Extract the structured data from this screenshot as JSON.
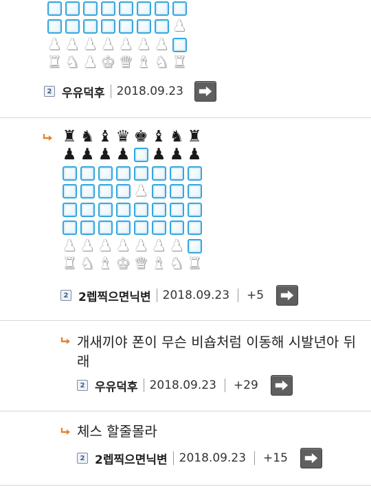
{
  "comments": [
    {
      "board_top": [
        "BOX",
        "BOX",
        "BOX",
        "BOX",
        "BOX",
        "BOX",
        "BOX",
        "BOX"
      ],
      "board": [
        [
          "BOX",
          "BOX",
          "BOX",
          "BOX",
          "BOX",
          "BOX",
          "BOX",
          "WP"
        ],
        [
          "WP",
          "WP",
          "WP",
          "WP",
          "WP",
          "WP",
          "WP",
          "BOX"
        ],
        [
          "WR",
          "WN",
          "WP",
          "WK",
          "WQ",
          "WB",
          "WN",
          "WR"
        ]
      ],
      "nick": "우유덕후",
      "date": "2018.09.23",
      "score": ""
    },
    {
      "board": [
        [
          "BR",
          "BN",
          "BB",
          "BQ",
          "BK",
          "BB",
          "BN",
          "BR"
        ],
        [
          "BP",
          "BP",
          "BP",
          "BP",
          "BOX",
          "BP",
          "BP",
          "BP"
        ],
        [
          "BOX",
          "BOX",
          "BOX",
          "BOX",
          "BOX",
          "BOX",
          "BOX",
          "BOX"
        ],
        [
          "BOX",
          "BOX",
          "BOX",
          "BOX",
          "WP",
          "BOX",
          "BOX",
          "BOX"
        ],
        [
          "BOX",
          "BOX",
          "BOX",
          "BOX",
          "BOX",
          "BOX",
          "BOX",
          "BOX"
        ],
        [
          "BOX",
          "BOX",
          "BOX",
          "BOX",
          "BOX",
          "BOX",
          "BOX",
          "BOX"
        ],
        [
          "WP",
          "WP",
          "WP",
          "WP",
          "WP",
          "WP",
          "WP",
          "BOX"
        ],
        [
          "WR",
          "WN",
          "WB",
          "WK",
          "WQ",
          "WB",
          "WN",
          "WR"
        ]
      ],
      "nick": "2렙찍으면닉변",
      "date": "2018.09.23",
      "score": "+5"
    },
    {
      "text_line1": "개새끼야 폰이 무슨 비숍처럼 이동해 시발년아 뒤",
      "text_line2": "래",
      "nick": "우유덕후",
      "date": "2018.09.23",
      "score": "+29"
    },
    {
      "text_line1": "체스 할줄몰라",
      "nick": "2렙찍으면닉변",
      "date": "2018.09.23",
      "score": "+15"
    }
  ],
  "level_badge": "2",
  "icons": {
    "reply": "reply-arrow-icon",
    "arrow_button": "right-arrow-icon",
    "level": "level-badge-icon"
  },
  "colors": {
    "square_border": "#35a6dc",
    "reply_arrow": "#e8812a",
    "button_bg": "#5f5f5f"
  }
}
